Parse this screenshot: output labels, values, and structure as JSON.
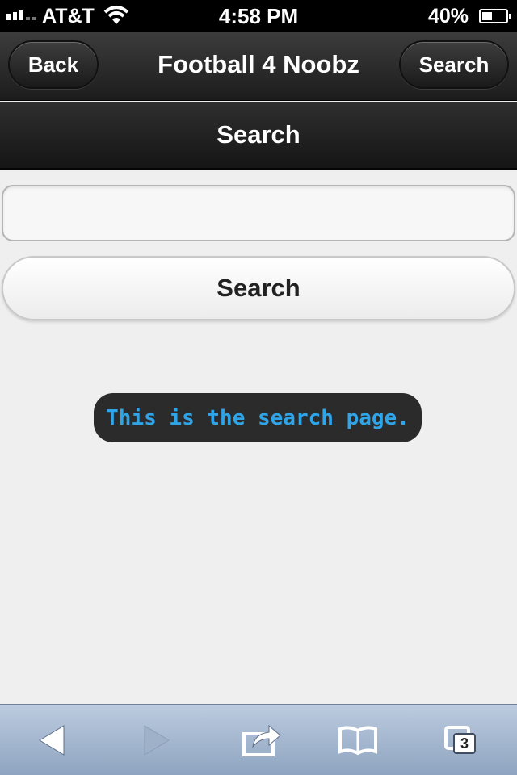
{
  "status_bar": {
    "carrier": "AT&T",
    "time": "4:58 PM",
    "battery_percent": "40%",
    "battery_level": 0.4
  },
  "header": {
    "back_label": "Back",
    "title": "Football 4 Noobz",
    "search_label": "Search"
  },
  "sub_header": {
    "title": "Search"
  },
  "search": {
    "input_value": "",
    "placeholder": "",
    "button_label": "Search"
  },
  "toast": {
    "message": "This is the search page."
  },
  "toolbar": {
    "tab_count": "3",
    "icons": [
      "back-arrow-icon",
      "forward-arrow-icon",
      "share-icon",
      "bookmarks-icon",
      "tabs-icon"
    ]
  },
  "colors": {
    "toast_text": "#2fa4e7",
    "header_bg": "#2a2a2a",
    "page_bg": "#efefef",
    "toolbar_bg": "#a5b7cf"
  }
}
